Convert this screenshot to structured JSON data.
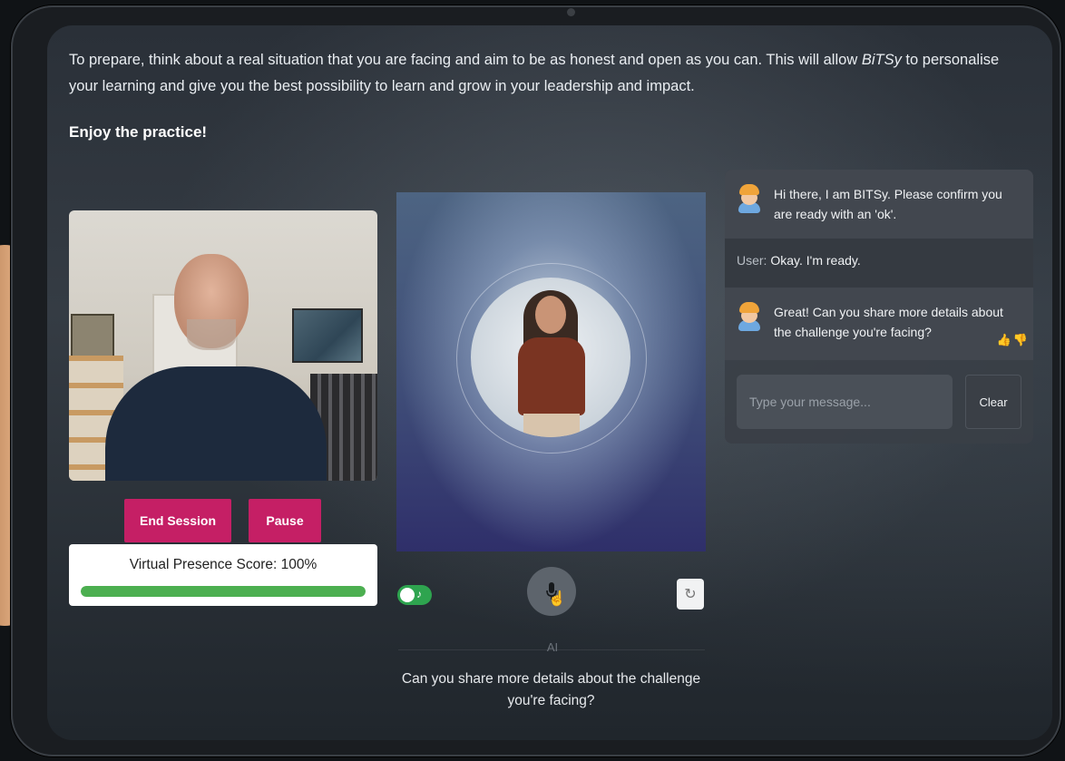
{
  "intro": {
    "text_before": "To prepare, think about a real situation that you are facing and aim to be as honest and open as you can. This will allow ",
    "brand": "BiTSy",
    "text_after": " to personalise your learning and give you the best possibility to learn and grow in your leadership and impact.",
    "enjoy": "Enjoy the practice!"
  },
  "controls": {
    "end_session": "End Session",
    "pause": "Pause"
  },
  "score": {
    "label": "Virtual Presence Score:",
    "value": "100%",
    "fraction": 1.0
  },
  "ai": {
    "label": "AI",
    "caption": "Can you share more details about the challenge you're facing?"
  },
  "chat": {
    "messages": [
      {
        "role": "bot",
        "text": "Hi there, I am BITSy. Please confirm you are ready with an 'ok'."
      },
      {
        "role": "user",
        "prefix": "User:",
        "text": "Okay. I'm ready."
      },
      {
        "role": "bot",
        "text": "Great! Can you share more details about the challenge you're facing?"
      }
    ],
    "input_placeholder": "Type your message...",
    "clear_label": "Clear"
  },
  "icons": {
    "mic": "microphone-icon",
    "refresh": "refresh-icon",
    "toggle": "audio-toggle-icon",
    "thumbs": "thumbs-up-down-icon"
  },
  "colors": {
    "accent": "#c51f65",
    "progress": "#4caf50",
    "toggle": "#2ea44f"
  }
}
